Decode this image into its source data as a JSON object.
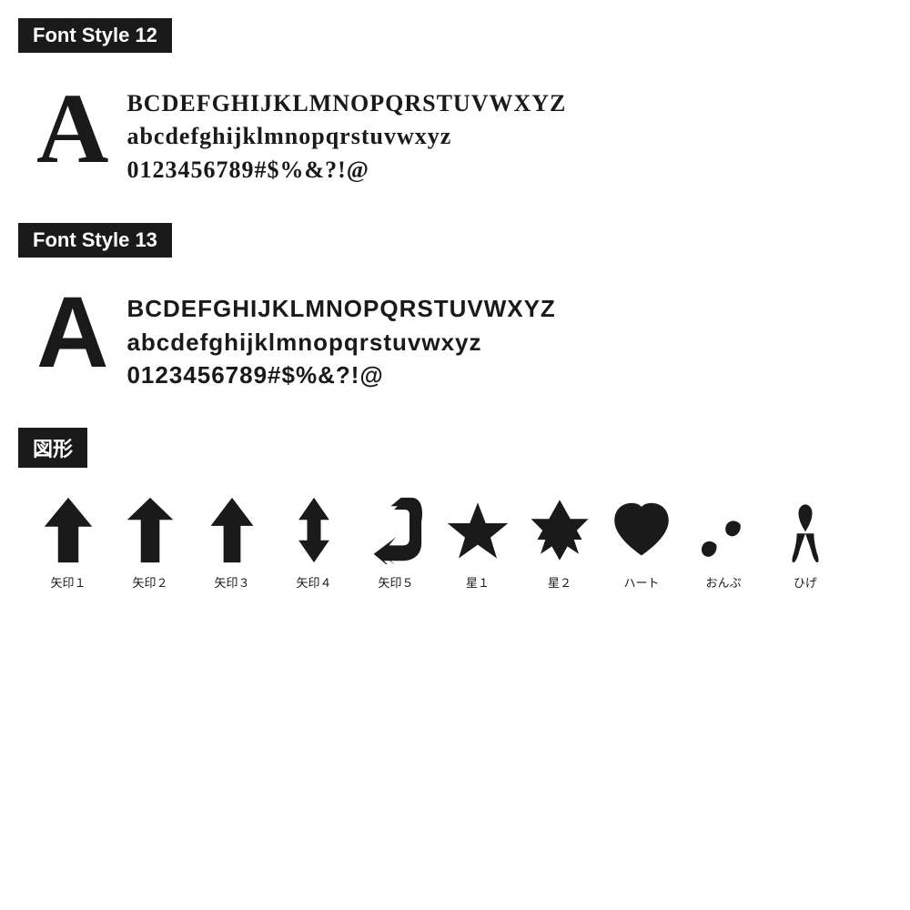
{
  "font_style_12": {
    "label": "Font Style 12",
    "big_letter": "A",
    "rows": [
      "BCDEFGHIJKLMNOPQRSTUVWXYZ",
      "abcdefghijklmnopqrstuvwxyz",
      "0123456789#$%&?!@"
    ]
  },
  "font_style_13": {
    "label": "Font Style 13",
    "big_letter": "A",
    "rows": [
      "BCDEFGHIJKLMNOPQRSTUVWXYZ",
      "abcdefghijklmnopqrstuvwxyz",
      "0123456789#$%&?!@"
    ]
  },
  "shapes_section": {
    "label": "図形",
    "shapes": [
      {
        "id": "arrow1",
        "label": "矢印１"
      },
      {
        "id": "arrow2",
        "label": "矢印２"
      },
      {
        "id": "arrow3",
        "label": "矢印３"
      },
      {
        "id": "arrow4",
        "label": "矢印４"
      },
      {
        "id": "arrow5",
        "label": "矢印５"
      },
      {
        "id": "star1",
        "label": "星１"
      },
      {
        "id": "star2",
        "label": "星２"
      },
      {
        "id": "heart",
        "label": "ハート"
      },
      {
        "id": "note",
        "label": "おんぷ"
      },
      {
        "id": "hige",
        "label": "ひげ"
      }
    ]
  }
}
